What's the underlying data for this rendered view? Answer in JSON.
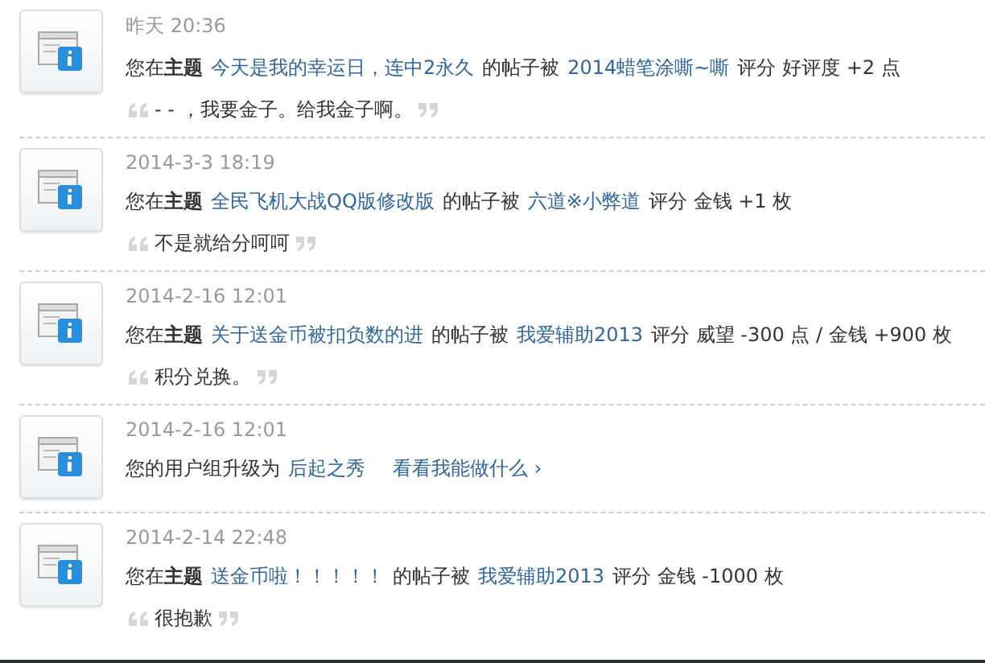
{
  "notices": [
    {
      "time": "昨天 20:36",
      "message": [
        {
          "kind": "text",
          "text": "您在**主题**"
        },
        {
          "kind": "link",
          "text": "今天是我的幸运日，连中2永久"
        },
        {
          "kind": "text",
          "text": "的帖子被"
        },
        {
          "kind": "link",
          "text": "2014蜡笔涂嘶~嘶"
        },
        {
          "kind": "text",
          "text": "评分 好评度 +2 点"
        }
      ],
      "quote": "- - ，我要金子。给我金子啊。"
    },
    {
      "time": "2014-3-3 18:19",
      "message": [
        {
          "kind": "text",
          "text": "您在**主题**"
        },
        {
          "kind": "link",
          "text": "全民飞机大战QQ版修改版"
        },
        {
          "kind": "text",
          "text": "的帖子被"
        },
        {
          "kind": "link",
          "text": "六道※小弊道"
        },
        {
          "kind": "text",
          "text": "评分 金钱 +1 枚"
        }
      ],
      "quote": "不是就给分呵呵"
    },
    {
      "time": "2014-2-16 12:01",
      "message": [
        {
          "kind": "text",
          "text": "您在**主题**"
        },
        {
          "kind": "link",
          "text": "关于送金币被扣负数的进"
        },
        {
          "kind": "text",
          "text": "的帖子被"
        },
        {
          "kind": "link",
          "text": "我爱辅助2013"
        },
        {
          "kind": "text",
          "text": "评分 威望 -300 点 / 金钱 +900 枚"
        }
      ],
      "quote": "积分兑换。"
    },
    {
      "time": "2014-2-16 12:01",
      "message": [
        {
          "kind": "text",
          "text": "您的用户组升级为"
        },
        {
          "kind": "link",
          "text": "后起之秀"
        },
        {
          "kind": "link",
          "text": "看看我能做什么 ›"
        }
      ]
    },
    {
      "time": "2014-2-14 22:48",
      "message": [
        {
          "kind": "text",
          "text": "您在**主题**"
        },
        {
          "kind": "link",
          "text": "送金币啦！！！！！"
        },
        {
          "kind": "text",
          "text": "的帖子被"
        },
        {
          "kind": "link",
          "text": "我爱辅助2013"
        },
        {
          "kind": "text",
          "text": "评分 金钱 -1000 枚"
        }
      ],
      "quote": "很抱歉"
    }
  ]
}
